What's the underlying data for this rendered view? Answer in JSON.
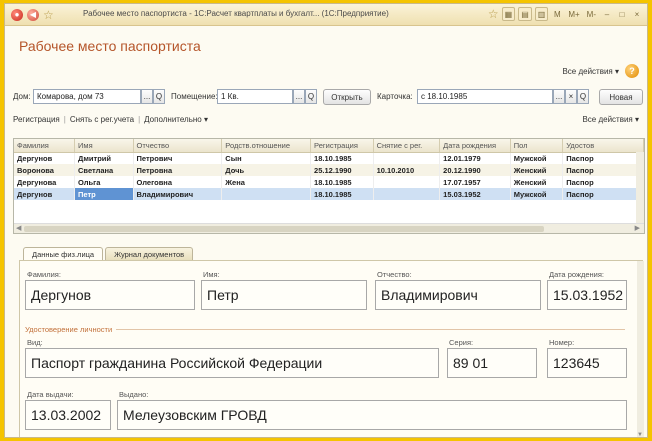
{
  "window": {
    "title": "Рабочее место паспортиста - 1С:Расчет квартплаты и бухгалт... (1С:Предприятие)",
    "toolbar_items": [
      "M",
      "M+",
      "M-",
      "–",
      "□",
      "×"
    ]
  },
  "page": {
    "title": "Рабочее место паспортиста",
    "all_actions": "Все действия ▾",
    "help": "?"
  },
  "filters": {
    "house_label": "Дом:",
    "house_value": "Комарова, дом 73",
    "room_label": "Помещение:",
    "room_value": "1 Кв.",
    "open_button": "Открыть",
    "card_label": "Карточка:",
    "card_value": "с 18.10.1985",
    "new_button": "Новая",
    "select_glyph": "...",
    "search_glyph": "Q",
    "clear_glyph": "×"
  },
  "links": {
    "registration": "Регистрация",
    "deregister": "Снять с рег.учета",
    "additional": "Дополнительно ▾",
    "all_actions": "Все действия ▾"
  },
  "table": {
    "columns": [
      "Фамилия",
      "Имя",
      "Отчество",
      "Родств.отношение",
      "Регистрация",
      "Снятие с рег.",
      "Дата рождения",
      "Пол",
      "Удостов"
    ],
    "rows": [
      [
        "Дергунов",
        "Дмитрий",
        "Петрович",
        "Сын",
        "18.10.1985",
        "",
        "12.01.1979",
        "Мужской",
        "Паспор"
      ],
      [
        "Воронова",
        "Светлана",
        "Петровна",
        "Дочь",
        "25.12.1990",
        "10.10.2010",
        "20.12.1990",
        "Женский",
        "Паспор"
      ],
      [
        "Дергунова",
        "Ольга",
        "Олеговна",
        "Жена",
        "18.10.1985",
        "",
        "17.07.1957",
        "Женский",
        "Паспор"
      ],
      [
        "Дергунов",
        "Петр",
        "Владимирович",
        "",
        "18.10.1985",
        "",
        "15.03.1952",
        "Мужской",
        "Паспор"
      ]
    ],
    "selected_row": 3
  },
  "tabs": [
    "Данные физ.лица",
    "Журнал документов"
  ],
  "details": {
    "surname_label": "Фамилия:",
    "surname": "Дергунов",
    "name_label": "Имя:",
    "name": "Петр",
    "patronymic_label": "Отчество:",
    "patronymic": "Владимирович",
    "birth_label": "Дата рождения:",
    "birth": "15.03.1952",
    "id_section": "Удостоверение личности",
    "kind_label": "Вид:",
    "kind": "Паспорт гражданина Российской Федерации",
    "series_label": "Серия:",
    "series": "89 01",
    "number_label": "Номер:",
    "number": "123645",
    "issue_date_label": "Дата выдачи:",
    "issue_date": "13.03.2002",
    "issuer_label": "Выдано:",
    "issuer": "Мелеузовским ГРОВД"
  },
  "colors": {
    "accent_title": "#b5552a",
    "selection": "#cfe0f3",
    "frame": "#f5c400"
  }
}
